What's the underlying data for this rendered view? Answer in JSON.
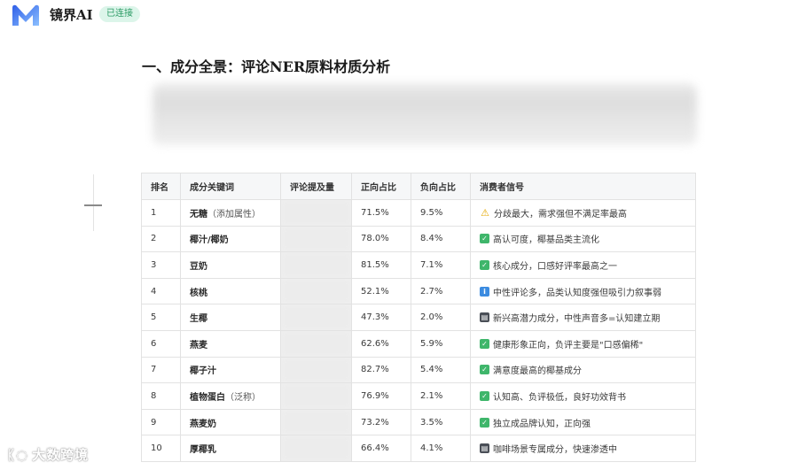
{
  "app": {
    "brand": "镜界AI",
    "status_badge": "已连接",
    "logo_color_start": "#3a6df0",
    "logo_color_end": "#7fb3ff"
  },
  "section": {
    "title": "一、成分全景：评论NER原料材质分析"
  },
  "table": {
    "headers": [
      "排名",
      "成分关键词",
      "评论提及量",
      "正向占比",
      "负向占比",
      "消费者信号"
    ],
    "rows": [
      {
        "rank": "1",
        "keyword": "无糖",
        "note": "（添加属性）",
        "positive": "71.5%",
        "negative": "9.5%",
        "icon": "warning-icon",
        "signal": "分歧最大，需求强但不满足率最高"
      },
      {
        "rank": "2",
        "keyword": "椰汁/椰奶",
        "note": "",
        "positive": "78.0%",
        "negative": "8.4%",
        "icon": "check-icon",
        "signal": "高认可度，椰基品类主流化"
      },
      {
        "rank": "3",
        "keyword": "豆奶",
        "note": "",
        "positive": "81.5%",
        "negative": "7.1%",
        "icon": "check-icon",
        "signal": "核心成分，口感好评率最高之一"
      },
      {
        "rank": "4",
        "keyword": "核桃",
        "note": "",
        "positive": "52.1%",
        "negative": "2.7%",
        "icon": "info-icon",
        "signal": "中性评论多，品类认知度强但吸引力叙事弱"
      },
      {
        "rank": "5",
        "keyword": "生椰",
        "note": "",
        "positive": "47.3%",
        "negative": "2.0%",
        "icon": "chart-icon",
        "signal": "新兴高潜力成分，中性声音多=认知建立期"
      },
      {
        "rank": "6",
        "keyword": "燕麦",
        "note": "",
        "positive": "62.6%",
        "negative": "5.9%",
        "icon": "check-icon",
        "signal": "健康形象正向，负评主要是\"口感偏稀\""
      },
      {
        "rank": "7",
        "keyword": "椰子汁",
        "note": "",
        "positive": "82.7%",
        "negative": "5.4%",
        "icon": "check-icon",
        "signal": "满意度最高的椰基成分"
      },
      {
        "rank": "8",
        "keyword": "植物蛋白",
        "note": "（泛称）",
        "positive": "76.9%",
        "negative": "2.1%",
        "icon": "check-icon",
        "signal": "认知高、负评极低，良好功效背书"
      },
      {
        "rank": "9",
        "keyword": "燕麦奶",
        "note": "",
        "positive": "73.2%",
        "negative": "3.5%",
        "icon": "check-icon",
        "signal": "独立成品牌认知，正向强"
      },
      {
        "rank": "10",
        "keyword": "厚椰乳",
        "note": "",
        "positive": "66.4%",
        "negative": "4.1%",
        "icon": "chart-icon",
        "signal": "咖啡场景专属成分，快速渗透中"
      }
    ]
  },
  "watermark": {
    "text": "大数跨境"
  }
}
